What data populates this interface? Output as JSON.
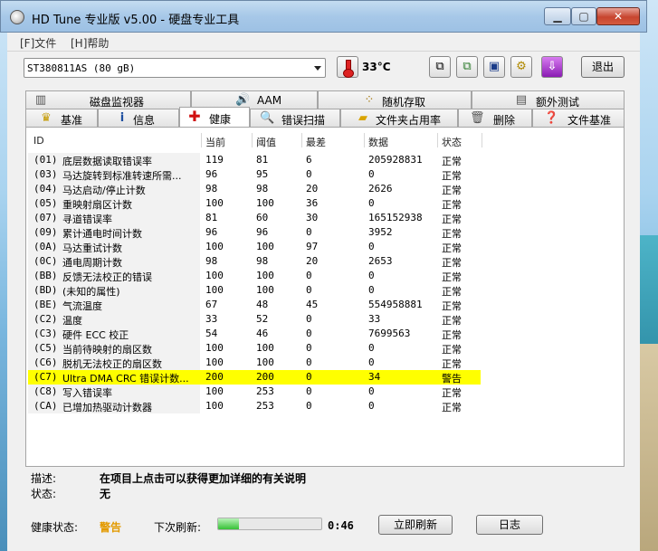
{
  "window": {
    "title": "HD Tune 专业版 v5.00 - 硬盘专业工具"
  },
  "window_controls": {
    "minimize": "▁",
    "maximize": "▢",
    "close": "✕"
  },
  "menu": [
    {
      "label": "[F]文件"
    },
    {
      "label": "[H]帮助"
    }
  ],
  "toolbar": {
    "drive": "ST380811AS (80 gB)",
    "temperature": "33°C",
    "exit_label": "退出",
    "icons": [
      "copy-icon",
      "copy-all-icon",
      "save-icon",
      "options-icon",
      "download-icon"
    ]
  },
  "tabs_top": [
    {
      "label": "磁盘监视器",
      "icon": "monitor-icon"
    },
    {
      "label": "AAM",
      "icon": "speaker-icon"
    },
    {
      "label": "随机存取",
      "icon": "random-access-icon"
    },
    {
      "label": "额外测试",
      "icon": "extra-tests-icon"
    }
  ],
  "tabs_bottom": [
    {
      "label": "基准",
      "icon": "benchmark-icon"
    },
    {
      "label": "信息",
      "icon": "info-icon"
    },
    {
      "label": "健康",
      "icon": "health-icon"
    },
    {
      "label": "错误扫描",
      "icon": "error-scan-icon"
    },
    {
      "label": "文件夹占用率",
      "icon": "folder-usage-icon"
    },
    {
      "label": "删除",
      "icon": "erase-icon"
    },
    {
      "label": "文件基准",
      "icon": "file-benchmark-icon"
    }
  ],
  "active_tab": "健康",
  "table": {
    "headers": [
      "ID",
      "当前",
      "阈值",
      "最差",
      "数据",
      "状态"
    ],
    "rows": [
      {
        "id": "(01)",
        "name": "底层数据读取错误率",
        "cur": "119",
        "thr": "81",
        "worst": "6",
        "data": "205928831",
        "status": "正常"
      },
      {
        "id": "(03)",
        "name": "马达旋转到标准转速所需...",
        "cur": "96",
        "thr": "95",
        "worst": "0",
        "data": "0",
        "status": "正常"
      },
      {
        "id": "(04)",
        "name": "马达启动/停止计数",
        "cur": "98",
        "thr": "98",
        "worst": "20",
        "data": "2626",
        "status": "正常"
      },
      {
        "id": "(05)",
        "name": "重映射扇区计数",
        "cur": "100",
        "thr": "100",
        "worst": "36",
        "data": "0",
        "status": "正常"
      },
      {
        "id": "(07)",
        "name": "寻道错误率",
        "cur": "81",
        "thr": "60",
        "worst": "30",
        "data": "165152938",
        "status": "正常"
      },
      {
        "id": "(09)",
        "name": "累计通电时间计数",
        "cur": "96",
        "thr": "96",
        "worst": "0",
        "data": "3952",
        "status": "正常"
      },
      {
        "id": "(0A)",
        "name": "马达重试计数",
        "cur": "100",
        "thr": "100",
        "worst": "97",
        "data": "0",
        "status": "正常"
      },
      {
        "id": "(0C)",
        "name": "通电周期计数",
        "cur": "98",
        "thr": "98",
        "worst": "20",
        "data": "2653",
        "status": "正常"
      },
      {
        "id": "(BB)",
        "name": "反馈无法校正的错误",
        "cur": "100",
        "thr": "100",
        "worst": "0",
        "data": "0",
        "status": "正常"
      },
      {
        "id": "(BD)",
        "name": "(未知的属性)",
        "cur": "100",
        "thr": "100",
        "worst": "0",
        "data": "0",
        "status": "正常"
      },
      {
        "id": "(BE)",
        "name": "气流温度",
        "cur": "67",
        "thr": "48",
        "worst": "45",
        "data": "554958881",
        "status": "正常"
      },
      {
        "id": "(C2)",
        "name": "温度",
        "cur": "33",
        "thr": "52",
        "worst": "0",
        "data": "33",
        "status": "正常"
      },
      {
        "id": "(C3)",
        "name": "硬件 ECC 校正",
        "cur": "54",
        "thr": "46",
        "worst": "0",
        "data": "7699563",
        "status": "正常"
      },
      {
        "id": "(C5)",
        "name": "当前待映射的扇区数",
        "cur": "100",
        "thr": "100",
        "worst": "0",
        "data": "0",
        "status": "正常"
      },
      {
        "id": "(C6)",
        "name": "脱机无法校正的扇区数",
        "cur": "100",
        "thr": "100",
        "worst": "0",
        "data": "0",
        "status": "正常"
      },
      {
        "id": "(C7)",
        "name": "Ultra DMA CRC 错误计数...",
        "cur": "200",
        "thr": "200",
        "worst": "0",
        "data": "34",
        "status": "警告",
        "warn": true
      },
      {
        "id": "(C8)",
        "name": "写入错误率",
        "cur": "100",
        "thr": "253",
        "worst": "0",
        "data": "0",
        "status": "正常"
      },
      {
        "id": "(CA)",
        "name": "已增加热驱动计数器",
        "cur": "100",
        "thr": "253",
        "worst": "0",
        "data": "0",
        "status": "正常"
      }
    ]
  },
  "description": {
    "desc_label": "描述:",
    "desc_value": "在项目上点击可以获得更加详细的有关说明",
    "state_label": "状态:",
    "state_value": "无"
  },
  "footer": {
    "health_label": "健康状态:",
    "health_value": "警告",
    "next_refresh_label": "下次刷新:",
    "refresh_progress_percent": 20,
    "timer": "0:46",
    "refresh_button": "立即刷新",
    "log_button": "日志"
  },
  "colors": {
    "warning_row": "#ffff00",
    "warning_text": "#e39a00",
    "progress": "#36c236"
  }
}
